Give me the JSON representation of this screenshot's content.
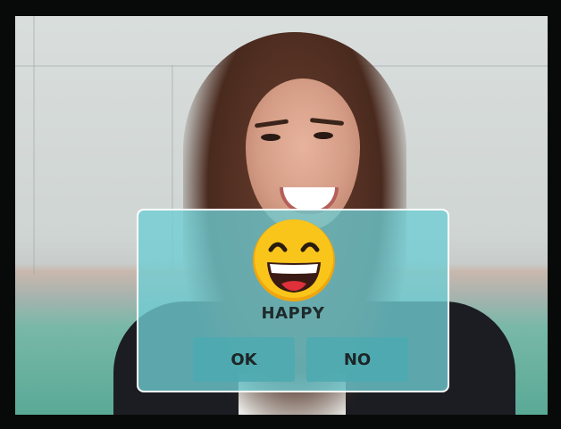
{
  "dialog": {
    "emoji_icon": "grinning-face-icon",
    "mood_label": "HAPPY",
    "ok_label": "OK",
    "no_label": "NO"
  },
  "colors": {
    "dialog_bg": "#6ECDD4",
    "button_bg": "#4EAAB0",
    "emoji_yellow": "#F9C51B",
    "text": "#1E2A2B"
  }
}
